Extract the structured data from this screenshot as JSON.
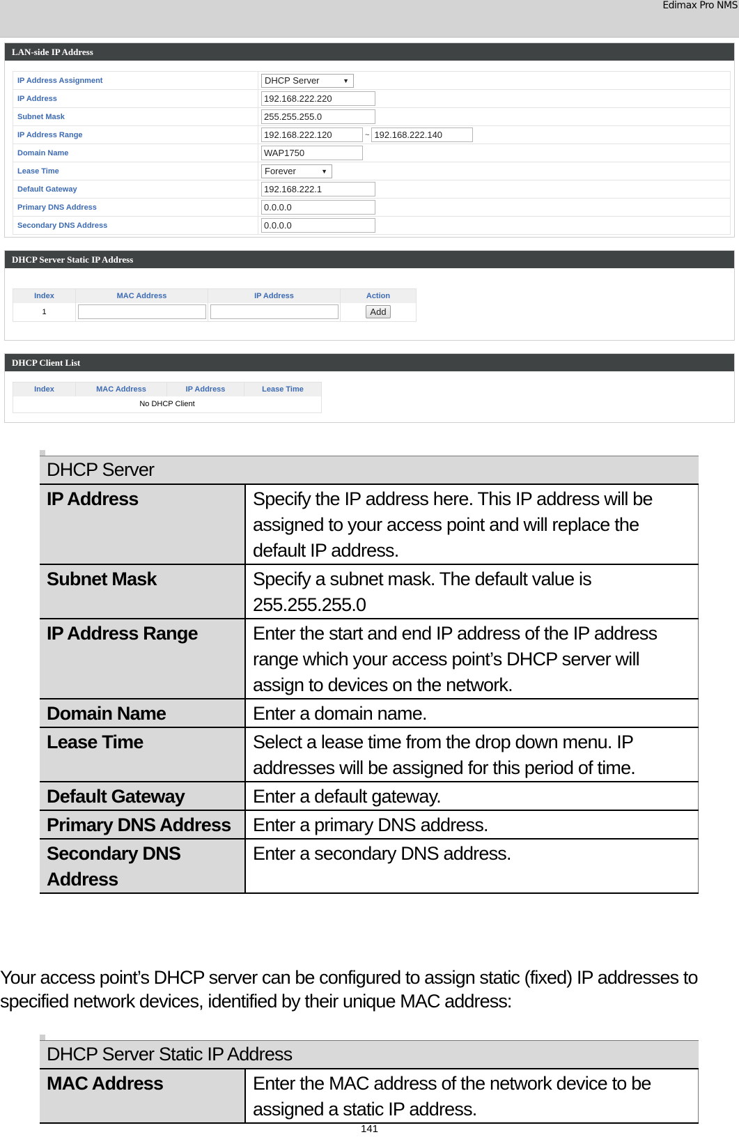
{
  "header": {
    "brand": "Edimax Pro NMS"
  },
  "lan_panel": {
    "title": "LAN-side IP Address",
    "rows": {
      "assignment": {
        "label": "IP Address Assignment",
        "value": "DHCP Server"
      },
      "ip": {
        "label": "IP Address",
        "value": "192.168.222.220"
      },
      "subnet": {
        "label": "Subnet Mask",
        "value": "255.255.255.0"
      },
      "range": {
        "label": "IP Address Range",
        "start": "192.168.222.120",
        "separator": "~",
        "end": "192.168.222.140"
      },
      "domain": {
        "label": "Domain Name",
        "value": "WAP1750"
      },
      "lease": {
        "label": "Lease Time",
        "value": "Forever"
      },
      "gateway": {
        "label": "Default Gateway",
        "value": "192.168.222.1"
      },
      "dns1": {
        "label": "Primary DNS Address",
        "value": "0.0.0.0"
      },
      "dns2": {
        "label": "Secondary DNS Address",
        "value": "0.0.0.0"
      }
    }
  },
  "static_panel": {
    "title": "DHCP Server Static IP Address",
    "columns": [
      "Index",
      "MAC Address",
      "IP Address",
      "Action"
    ],
    "row": {
      "index": "1",
      "mac": "",
      "ip": "",
      "action": "Add"
    }
  },
  "client_panel": {
    "title": "DHCP Client List",
    "columns": [
      "Index",
      "MAC Address",
      "IP Address",
      "Lease Time"
    ],
    "empty": "No DHCP Client"
  },
  "dhcp_table": {
    "title": "DHCP Server",
    "rows": [
      {
        "key": "IP Address",
        "desc": "Specify the IP address here. This IP address will be assigned to your access point and will replace the default IP address."
      },
      {
        "key": "Subnet Mask",
        "desc": "Specify a subnet mask. The default value is 255.255.255.0"
      },
      {
        "key": "IP Address Range",
        "desc": "Enter the start and end IP address of the IP address range which your access point’s DHCP server will assign to devices on the network."
      },
      {
        "key": "Domain Name",
        "desc": "Enter a domain name."
      },
      {
        "key": "Lease Time",
        "desc": "Select a lease time from the drop down menu. IP addresses will be assigned for this period of time."
      },
      {
        "key": "Default Gateway",
        "desc": "Enter a default gateway."
      },
      {
        "key": "Primary DNS Address",
        "desc": "Enter a primary DNS address."
      },
      {
        "key": "Secondary DNS Address",
        "desc": "Enter a secondary DNS address."
      }
    ]
  },
  "intro": "Your access point’s DHCP server can be configured to assign static (fixed) IP addresses to specified network devices, identified by their unique MAC address:",
  "static_table": {
    "title": "DHCP Server Static IP Address",
    "rows": [
      {
        "key": "MAC Address",
        "desc": "Enter the MAC address of the network device to be assigned a static IP address."
      }
    ]
  },
  "page_number": "141"
}
